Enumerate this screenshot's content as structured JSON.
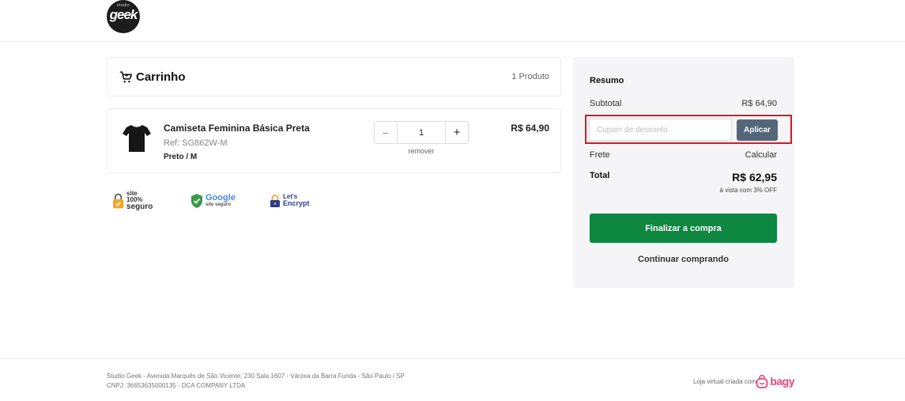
{
  "header": {
    "logo_small": "studio",
    "logo_main": "geek"
  },
  "cart": {
    "title": "Carrinho",
    "count_label": "1 Produto",
    "items": [
      {
        "name": "Camiseta Feminina Básica Preta",
        "ref": "Ref: SG862W-M",
        "variant": "Preto / M",
        "quantity": "1",
        "qty_minus": "−",
        "qty_plus": "+",
        "remove_label": "remover",
        "price": "R$ 64,90"
      }
    ]
  },
  "badges": {
    "secure": {
      "line1": "site 100%",
      "line2": "seguro",
      "color": "#f5a623"
    },
    "google": {
      "line1": "Google",
      "line2": "site seguro",
      "color": "#3a9a4a"
    },
    "letsencrypt": {
      "line1": "Let's",
      "line2": "Encrypt",
      "color": "#2a3d8f"
    }
  },
  "summary": {
    "title": "Resumo",
    "subtotal_label": "Subtotal",
    "subtotal_value": "R$ 64,90",
    "coupon_placeholder": "Cupom de desconto",
    "apply_label": "Aplicar",
    "shipping_label": "Frete",
    "shipping_value": "Calcular",
    "total_label": "Total",
    "total_value": "R$ 62,95",
    "total_note": "à vista com 3% OFF",
    "checkout_label": "Finalizar a compra",
    "continue_label": "Continuar comprando"
  },
  "footer": {
    "address_line1": "Studio Geek - Avenida Marquês de São Vicente, 230 Sala 1607 - Várzea da Barra Funda - São Paulo / SP",
    "address_line2": "CNPJ: 36653635000135 - DCA COMPANY LTDA",
    "made_with": "Loja virtual criada com",
    "brand": "bagy"
  },
  "colors": {
    "checkout_green": "#0e8740",
    "apply_slate": "#536778",
    "highlight_red": "#e0141f",
    "summary_bg": "#f5f5f7",
    "bagy_pink": "#e8457c"
  }
}
